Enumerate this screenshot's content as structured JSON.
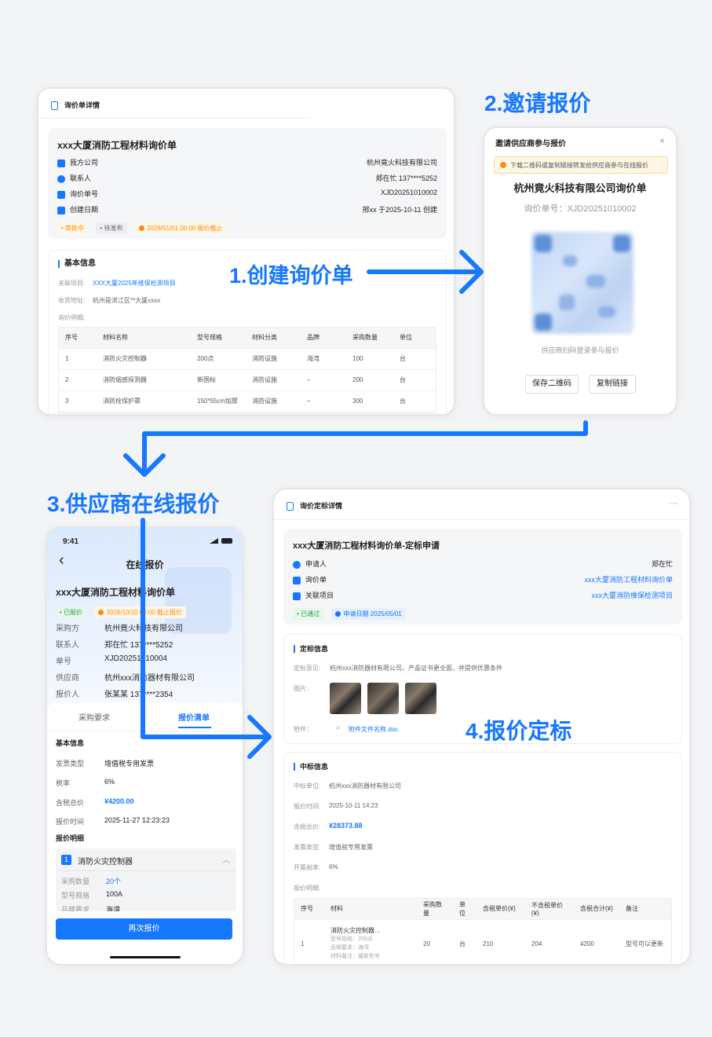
{
  "steps": {
    "s1": "1.创建询价单",
    "s2": "2.邀请报价",
    "s3": "3.供应商在线报价",
    "s4": "4.报价定标"
  },
  "panel1": {
    "header": "询价单详情",
    "title": "xxx大厦消防工程材料询价单",
    "rows": [
      {
        "label": "我方公司",
        "value": "杭州竟火科技有限公司"
      },
      {
        "label": "联系人",
        "value": "郑在忙 137****5252"
      },
      {
        "label": "询价单号",
        "value": "XJD20251010002"
      },
      {
        "label": "创建日期",
        "value": "邢xx 于2025-10-11 创建"
      }
    ],
    "tags": {
      "t1": "• 审批中",
      "t2": "• 待发布",
      "t3": "2026/01/01 00:00 报价截止"
    },
    "basic_title": "基本信息",
    "project_label": "关联项目:",
    "project_value": "XXX大厦2025年维保检测项目",
    "address_label": "收货地址:",
    "address_value": "杭州是滨江区**大厦xxxx",
    "detail_label": "询价明细:",
    "table_headers": [
      "序号",
      "材料名称",
      "型号规格",
      "材料分类",
      "品牌",
      "采购数量",
      "单位"
    ],
    "table_rows": [
      [
        "1",
        "消防火灾控制器",
        "200点",
        "消防设施",
        "海湾",
        "100",
        "台"
      ],
      [
        "2",
        "消防烟感探测器",
        "新国标",
        "消防设施",
        "–",
        "200",
        "台"
      ],
      [
        "3",
        "消防栓保护罩",
        "150*55cm加厚",
        "消防设施",
        "–",
        "300",
        "台"
      ]
    ]
  },
  "panel2": {
    "header": "邀请供应商参与报价",
    "close": "×",
    "notice": "下载二维码或复制链接转发给供应商参与在线报价",
    "company": "杭州竟火科技有限公司询价单",
    "order_no": "询价单号：XJD20251010002",
    "scan_hint": "供应商扫码登录参与报价",
    "save_btn": "保存二维码",
    "copy_btn": "复制链接"
  },
  "panel3": {
    "time": "9:41",
    "back": "‹",
    "title": "在线报价",
    "order_title": "xxx大厦消防工程材料询价单",
    "tag1": "• 已报价",
    "tag2": "2026/10/10 00:00 截止报价",
    "rows": [
      {
        "label": "采购方",
        "value": "杭州竟火科技有限公司"
      },
      {
        "label": "联系人",
        "value": "郑在忙  137****5252"
      },
      {
        "label": "单号",
        "value": "XJD20251010004"
      },
      {
        "label": "供应商",
        "value": "杭州xxx消防器材有限公司"
      },
      {
        "label": "报价人",
        "value": "张某某  137****2354"
      }
    ],
    "tab1": "采购要求",
    "tab2": "报价清单",
    "basic_title": "基本信息",
    "info": [
      {
        "label": "发票类型",
        "value": "增值税专用发票"
      },
      {
        "label": "税率",
        "value": "6%"
      },
      {
        "label": "含税总价",
        "value": "¥4200.00"
      },
      {
        "label": "报价时间",
        "value": "2025-11-27 12:23:23"
      }
    ],
    "detail_title": "报价明细",
    "item_no": "1",
    "item_name": "消防火灾控制器",
    "item_rows": [
      {
        "label": "采购数量",
        "value": "20个"
      },
      {
        "label": "型号规格",
        "value": "100A"
      },
      {
        "label": "品牌要求",
        "value": "海湾"
      }
    ],
    "submit": "再次报价"
  },
  "panel4": {
    "header": "询价定标详情",
    "more": "···",
    "title": "xxx大厦消防工程材料询价单-定标申请",
    "rows": [
      {
        "label": "申请人",
        "value": "郑在忙"
      },
      {
        "label": "询价单",
        "value": "xxx大厦消防工程材料询价单"
      },
      {
        "label": "关联项目",
        "value": "xxx大厦消防维保检测项目"
      }
    ],
    "tag1": "• 已通过",
    "tag2": "申请日期 2025/05/01",
    "award_title": "定标信息",
    "opinion_label": "定标意见:",
    "opinion_value": "杭州xxx消防器材有限公司，产品证书更全面，并提供优惠条件",
    "images_label": "图片:",
    "attach_label": "附件：",
    "attach_value": "附件文件名称.doc",
    "winner_title": "中标信息",
    "winner": [
      {
        "label": "中标单位:",
        "value": "杭州xxx消防器材有限公司"
      },
      {
        "label": "报价时间:",
        "value": "2025-10-11 14:23"
      },
      {
        "label": "含税总价:",
        "value": "¥28373.88"
      },
      {
        "label": "发票类型:",
        "value": "增值税专用发票"
      },
      {
        "label": "开票税率:",
        "value": "6%"
      },
      {
        "label": "报价明细:",
        "value": ""
      }
    ],
    "table_headers": [
      "序号",
      "材料",
      "采购数量",
      "单位",
      "含税单价(¥)",
      "不含税单价(¥)",
      "含税合计(¥)",
      "备注"
    ],
    "row": {
      "no": "1",
      "name": "消防火灾控制器...",
      "sub1": "型号规格：200点",
      "sub2": "品牌要求：海湾",
      "sub3": "材料备注：最新型号",
      "qty": "20",
      "unit": "台",
      "price": "210",
      "net": "204",
      "total": "4200",
      "note": "型号可以更新"
    }
  },
  "colors": {
    "accent": "#1677ff",
    "bg": "#f3f4f6"
  }
}
